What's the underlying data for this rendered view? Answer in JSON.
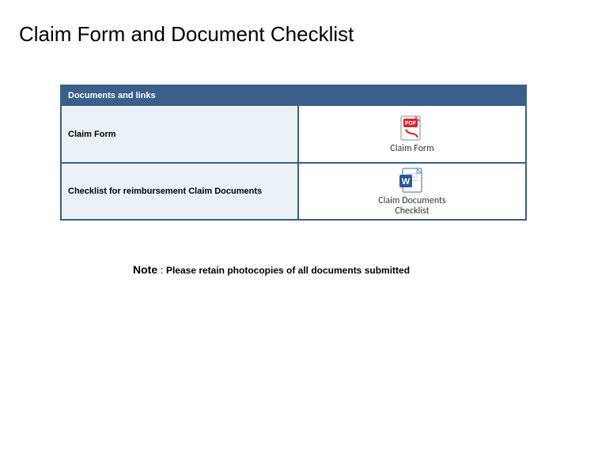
{
  "title": "Claim Form and Document Checklist",
  "table": {
    "header": "Documents and links",
    "rows": [
      {
        "label": "Claim Form",
        "file_caption": "Claim Form",
        "icon": "pdf"
      },
      {
        "label": "Checklist for reimbursement Claim Documents",
        "file_caption": "Claim Documents\nChecklist",
        "icon": "word"
      }
    ]
  },
  "note": {
    "label": "Note",
    "sep": " : ",
    "text": "Please retain photocopies of all documents submitted"
  }
}
